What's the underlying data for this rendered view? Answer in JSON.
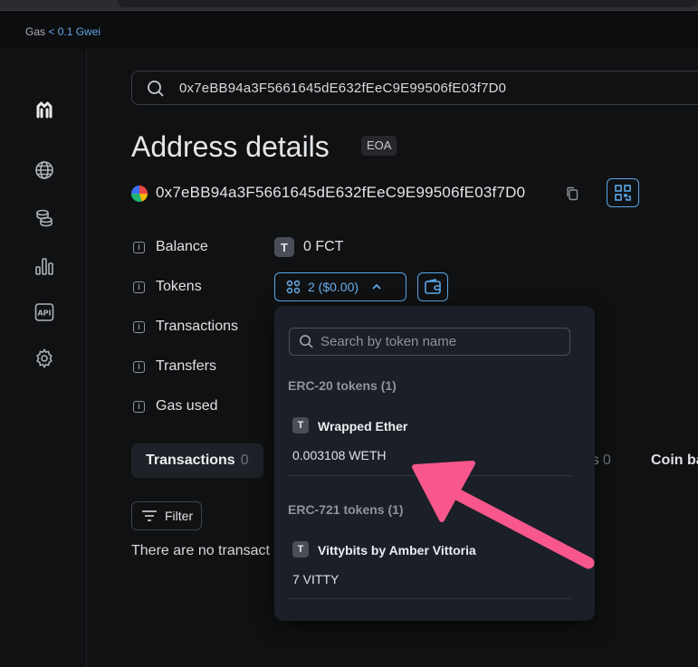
{
  "topbar": {
    "gas_label": "Gas",
    "gas_value": "< 0.1 Gwei"
  },
  "sidebar": {
    "items": [
      {
        "name": "logo",
        "icon": "brand-logo-icon"
      },
      {
        "name": "blockchain",
        "icon": "globe-icon"
      },
      {
        "name": "tokens",
        "icon": "coins-stack-icon"
      },
      {
        "name": "charts",
        "icon": "bar-chart-icon"
      },
      {
        "name": "api",
        "icon": "api-icon"
      },
      {
        "name": "settings",
        "icon": "gear-icon"
      }
    ]
  },
  "search": {
    "value": "0x7eBB94a3F5661645dE632fEeC9E99506fE03f7D0"
  },
  "page": {
    "title": "Address details",
    "badge": "EOA"
  },
  "address": {
    "hash": "0x7eBB94a3F5661645dE632fEeC9E99506fE03f7D0"
  },
  "details": {
    "rows": [
      {
        "label": "Balance"
      },
      {
        "label": "Tokens"
      },
      {
        "label": "Transactions"
      },
      {
        "label": "Transfers"
      },
      {
        "label": "Gas used"
      }
    ],
    "balance": {
      "badge": "T",
      "value": "0 FCT"
    },
    "tokens_button": "2 ($0.00)"
  },
  "tabs": {
    "active": {
      "label": "Transactions",
      "count": "0"
    },
    "partial_a": {
      "label": "ns",
      "count": "0"
    },
    "partial_b": {
      "label": "Coin ba"
    }
  },
  "filter": {
    "label": "Filter"
  },
  "empty_text": "There are no transact",
  "dropdown": {
    "search_placeholder": "Search by token name",
    "sections": [
      {
        "title": "ERC-20 tokens (1)",
        "tokens": [
          {
            "badge": "T",
            "name": "Wrapped Ether",
            "amount": "0.003108 WETH"
          }
        ]
      },
      {
        "title": "ERC-721 tokens (1)",
        "tokens": [
          {
            "badge": "T",
            "name": "Vittybits by Amber Vittoria",
            "amount": "7 VITTY"
          }
        ]
      }
    ]
  },
  "colors": {
    "accent": "#5aa7e8",
    "arrow": "#f7578c",
    "background": "#101112",
    "dropdown_bg": "#1b1f27"
  }
}
